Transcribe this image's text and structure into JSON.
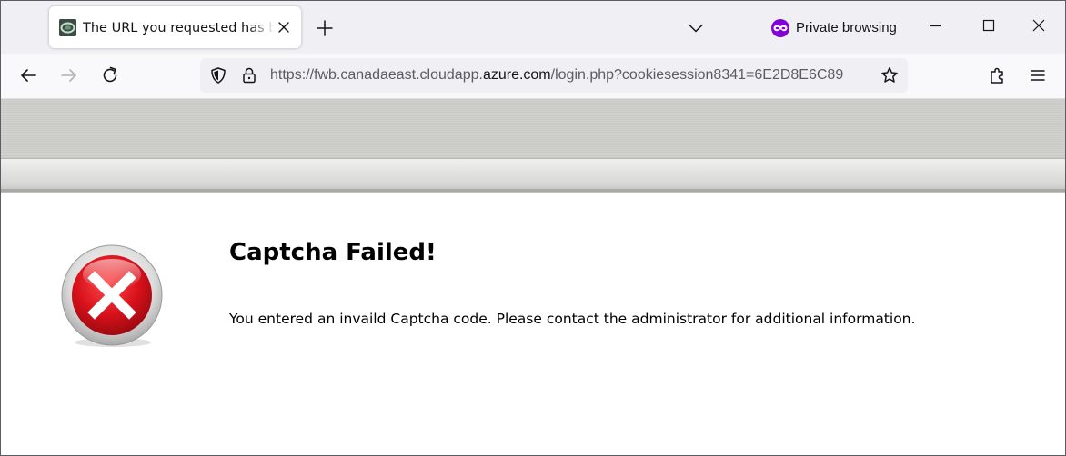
{
  "browser": {
    "tab": {
      "title": "The URL you requested has been blocked",
      "favicon": "site-favicon"
    },
    "tabstrip_icons": {
      "new_tab": "plus-icon",
      "list_tabs": "chevron-down-icon",
      "close_tab": "close-icon"
    },
    "private_browsing": {
      "label": "Private browsing",
      "icon": "private-mask-icon",
      "color": "#8000d7"
    },
    "window_controls": {
      "minimize": "minimize-icon",
      "maximize": "maximize-icon",
      "close": "close-icon"
    },
    "url": {
      "prefix": "https://fwb.canadaeast.cloudapp.",
      "host": "azure.com",
      "suffix": "/login.php?cookiesession8341=6E2D8E6C89"
    }
  },
  "page": {
    "heading": "Captcha Failed!",
    "message": "You entered an invaild Captcha code. Please contact the administrator for additional information.",
    "icon": "error-x-icon",
    "accent_color": "#d8111b"
  }
}
